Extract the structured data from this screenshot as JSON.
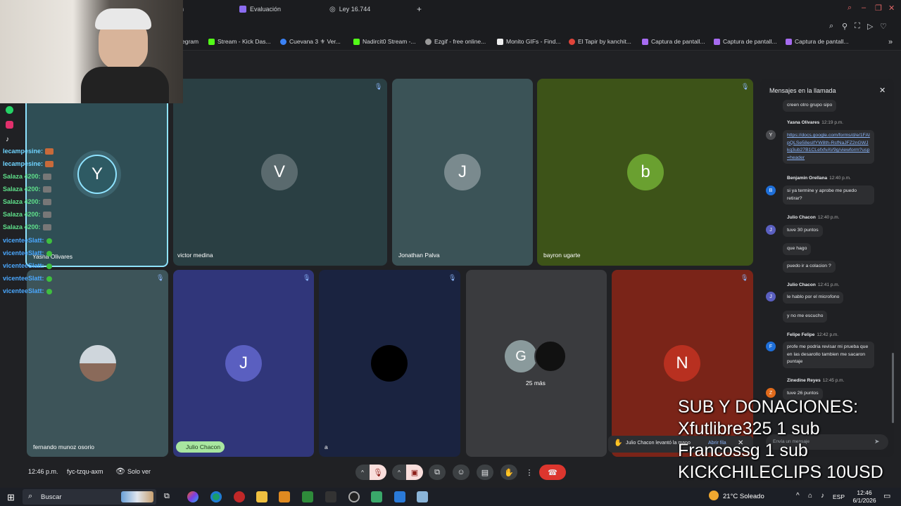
{
  "browser": {
    "tabs": [
      {
        "label": "n"
      },
      {
        "label": "Evaluación"
      },
      {
        "label": "Ley 16.744"
      }
    ],
    "new_tab": "+",
    "bookmarks": [
      "egram",
      "Stream - Kick Das...",
      "Cuevana 3 ⚜ Ver...",
      "Nadircit0 Stream -...",
      "Ezgif - free online...",
      "Monito GIFs - Find...",
      "El Tapir by kanchit...",
      "Captura de pantall...",
      "Captura de pantall...",
      "Captura de pantall..."
    ],
    "more_bookmarks": "»"
  },
  "participants": [
    {
      "initial": "Y",
      "name": "Yasna Olivares",
      "color": "#2e5a63"
    },
    {
      "initial": "V",
      "name": "victor medina",
      "color": "#5a6a6e"
    },
    {
      "initial": "J",
      "name": "Jonathan Palva",
      "color": "#7a8a8e"
    },
    {
      "initial": "b",
      "name": "bayron ugarte",
      "color": "#6aa030"
    },
    {
      "initial": "",
      "name": "fernando munoz osorio",
      "color": "#cfd6dc"
    },
    {
      "initial": "J",
      "name": "Julio Chacon",
      "color": "#5a5fc0"
    },
    {
      "initial": "",
      "name": "a",
      "color": "#000000"
    },
    {
      "initial": "G",
      "name": "25 más",
      "color": "#8a9a9c"
    },
    {
      "initial": "N",
      "name": "",
      "color": "#b83020"
    }
  ],
  "chat": {
    "title": "Mensajes en la llamada",
    "close": "✕",
    "messages": [
      {
        "text": "creen otro grupo sipo"
      },
      {
        "author": "Yasna Olivares",
        "time": "12:19 p.m.",
        "initial": "Y",
        "link": "https://docs.google.com/forms/d/e/1FAIpQLSe58esIfYW8th-RsfNaJFZ2nGWJkq3ub27B1CLefxfvAV9g/viewform?usp=header"
      },
      {
        "author": "Benjamin Orellana",
        "time": "12:40 p.m.",
        "initial": "B",
        "text": "si ya termine y aprobe me puedo retirar?"
      },
      {
        "author": "Julio Chacon",
        "time": "12:40 p.m.",
        "initial": "J",
        "lines": [
          "tuve 30 puntos",
          "que hago",
          "puedo ir a colacion ?"
        ]
      },
      {
        "author": "Julio Chacon",
        "time": "12:41 p.m.",
        "initial": "J",
        "lines": [
          "le hablo por el microfono",
          "y no me escucho"
        ]
      },
      {
        "author": "Felipe Felipe",
        "time": "12:42 p.m.",
        "initial": "F",
        "text": "profe me podria revisar mi prueba que en las desarollo tambien me sacaron puntaje"
      },
      {
        "author": "Zinedine Reyes",
        "time": "12:45 p.m.",
        "initial": "Z",
        "text": "tuve 26 puntos"
      }
    ],
    "input_placeholder": "Envía un mensaje",
    "send": "➤"
  },
  "toast": {
    "text": "Julio Chacon levantó la mano",
    "action": "Abrir fila",
    "close": "✕"
  },
  "meeting": {
    "time": "12:46 p.m.",
    "code": "fyc-tzqu-axm",
    "view_mode": "Solo ver"
  },
  "overlay": {
    "lines": [
      "SUB Y DONACIONES:",
      "Xfutlibre325 1 sub",
      "Francossg 1 sub",
      "KICKCHILECLIPS 10USD"
    ]
  },
  "stream_chat": [
    {
      "user": "lecampesine:",
      "color": "#6fd4ff"
    },
    {
      "user": "lecampesine:",
      "color": "#6fd4ff"
    },
    {
      "user": "Salaza 4200:",
      "color": "#5fe08a"
    },
    {
      "user": "Salaza 4200:",
      "color": "#5fe08a"
    },
    {
      "user": "Salaza 4200:",
      "color": "#5fe08a"
    },
    {
      "user": "Salaza 4200:",
      "color": "#5fe08a"
    },
    {
      "user": "Salaza 4200:",
      "color": "#5fe08a"
    },
    {
      "user": "vicenteeSlatt:",
      "color": "#4aa8ff"
    },
    {
      "user": "vicenteeSlatt:",
      "color": "#4aa8ff"
    },
    {
      "user": "vicenteeSlatt:",
      "color": "#4aa8ff"
    },
    {
      "user": "vicenteeSlatt:",
      "color": "#4aa8ff"
    },
    {
      "user": "vicenteeSlatt:",
      "color": "#4aa8ff"
    }
  ],
  "taskbar": {
    "search": "Buscar",
    "weather": "21°C Soleado",
    "language": "ESP",
    "clock_time": "12:46",
    "clock_date": "6/1/2026"
  }
}
